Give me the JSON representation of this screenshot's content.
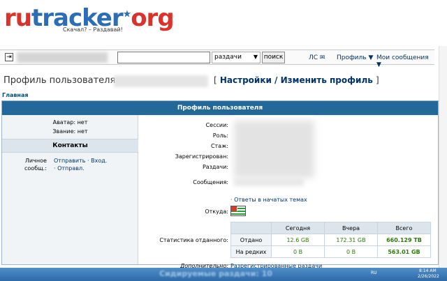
{
  "logo": {
    "text_ru": "ru",
    "text_tracker": "tracker",
    "text_org": "org",
    "slogan": "Скачал? – Раздавай!"
  },
  "toolbar": {
    "search_scope": "раздачи",
    "search_button": "поиск",
    "pm_link": "ЛС ✉",
    "profile_link": "Профиль ▼",
    "messages_link": "Мои сообщения ▼"
  },
  "page": {
    "title": "Профиль пользователя:",
    "settings_open": "[",
    "settings_link": "Настройки / Изменить профиль",
    "settings_close": "]",
    "home_link": "Главная"
  },
  "profile": {
    "header": "Профиль пользователя",
    "avatar": "Аватар: нет",
    "rank": "Звание: нет",
    "contacts_header": "Контакты",
    "pm_label_line1": "Личное",
    "pm_label_line2": "сообщ.:",
    "pm_send": "Отправить",
    "pm_in": "Вход.",
    "pm_out": "Отправл.",
    "labels": {
      "sessions": "Сессии:",
      "role": "Роль:",
      "experience": "Стаж:",
      "registered": "Зарегистрирован:",
      "releases": "Раздачи:",
      "messages": "Сообщения:",
      "from": "Откуда:",
      "stats": "Статистика отданного:",
      "additional": "Дополнительно:"
    },
    "messages_link": "Ответы в начатых темах",
    "additional_link": "Разрегистрированные раздачи",
    "stats_table": {
      "columns": [
        "Сегодня",
        "Вчера",
        "Всего"
      ],
      "rows": [
        {
          "label": "Отдано",
          "values": [
            "12.6 GB",
            "172.31 GB",
            "660.129 TB"
          ]
        },
        {
          "label": "На редких",
          "values": [
            "0 B",
            "0 B",
            "563.01 GB"
          ]
        }
      ]
    }
  },
  "taskbar": {
    "seeding": "Сидируемые раздачи: 10",
    "lang": "RU",
    "time": "8:14 AM",
    "date": "2/26/2022"
  }
}
